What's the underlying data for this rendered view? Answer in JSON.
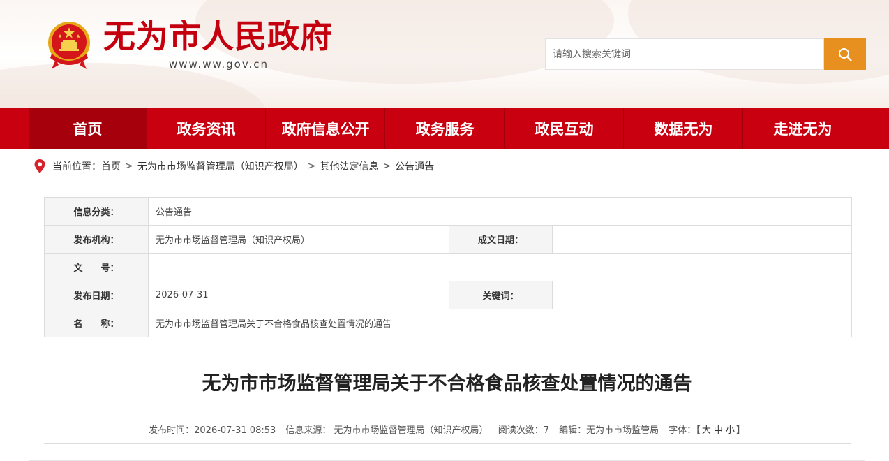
{
  "site": {
    "title": "无为市人民政府",
    "url": "www.ww.gov.cn"
  },
  "search": {
    "placeholder": "请输入搜索关键词"
  },
  "nav": {
    "items": [
      "首页",
      "政务资讯",
      "政府信息公开",
      "政务服务",
      "政民互动",
      "数据无为",
      "走进无为"
    ]
  },
  "breadcrumb": {
    "prefix": "当前位置：",
    "items": [
      "首页",
      "无为市市场监督管理局（知识产权局）",
      "其他法定信息",
      "公告通告"
    ]
  },
  "info": {
    "category_label": "信息分类：",
    "category_value": "公告通告",
    "publisher_label": "发布机构：",
    "publisher_value": "无为市市场监督管理局（知识产权局）",
    "date_written_label": "成文日期：",
    "date_written_value": "",
    "doc_no_label": "文　　号：",
    "doc_no_value": "",
    "publish_date_label": "发布日期：",
    "publish_date_value": "2026-07-31",
    "keywords_label": "关键词：",
    "keywords_value": "",
    "name_label": "名　　称：",
    "name_value": "无为市市场监督管理局关于不合格食品核查处置情况的通告"
  },
  "article": {
    "title": "无为市市场监督管理局关于不合格食品核查处置情况的通告",
    "meta_time": "发布时间：2026-07-31 08:53",
    "meta_source": "信息来源： 无为市市场监督管理局（知识产权局）",
    "meta_views": "阅读次数：7",
    "meta_editor": "编辑：无为市市场监管局",
    "meta_font_label": "字体：",
    "font_open": "【",
    "font_large": "大",
    "font_medium": "中",
    "font_small": "小",
    "font_close": "】"
  },
  "colors": {
    "brand_red": "#c8000f",
    "search_orange": "#e8901f"
  },
  "icons": {
    "emblem": "national-emblem-icon",
    "search": "search-icon",
    "location": "location-pin-icon"
  }
}
